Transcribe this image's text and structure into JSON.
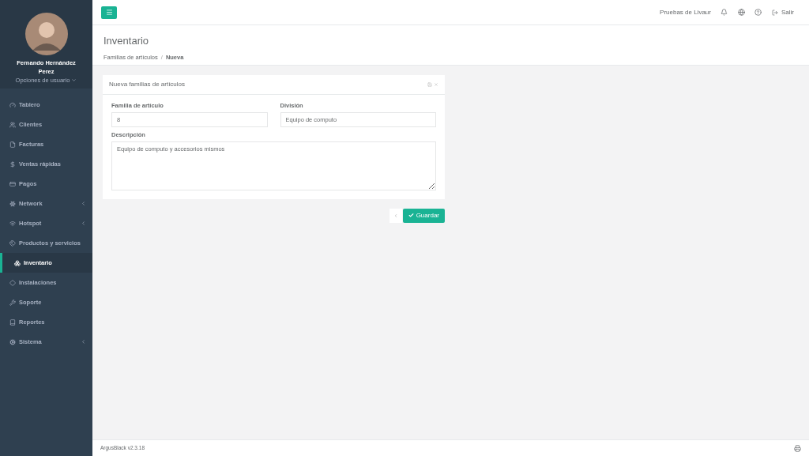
{
  "user": {
    "name": "Fernando Hernández Perez",
    "options": "Opciones de usuario"
  },
  "sidebar": {
    "items": [
      {
        "label": "Tablero",
        "has_submenu": false,
        "selected": false
      },
      {
        "label": "Clientes",
        "has_submenu": false,
        "selected": false
      },
      {
        "label": "Facturas",
        "has_submenu": false,
        "selected": false
      },
      {
        "label": "Ventas rápidas",
        "has_submenu": false,
        "selected": false
      },
      {
        "label": "Pagos",
        "has_submenu": false,
        "selected": false
      },
      {
        "label": "Network",
        "has_submenu": true,
        "selected": false
      },
      {
        "label": "Hotspot",
        "has_submenu": true,
        "selected": false
      },
      {
        "label": "Productos y servicios",
        "has_submenu": false,
        "selected": false
      },
      {
        "label": "Inventario",
        "has_submenu": false,
        "selected": true
      },
      {
        "label": "Instalaciones",
        "has_submenu": false,
        "selected": false
      },
      {
        "label": "Soporte",
        "has_submenu": false,
        "selected": false
      },
      {
        "label": "Reportes",
        "has_submenu": false,
        "selected": false
      },
      {
        "label": "Sistema",
        "has_submenu": true,
        "selected": false
      }
    ]
  },
  "topbar": {
    "account": "Pruebas de Livaur",
    "logout": "Salir"
  },
  "page": {
    "title": "Inventario",
    "breadcrumb": [
      "Familias de artículos",
      "Nueva"
    ],
    "breadcrumb_separator": "/"
  },
  "form": {
    "title": "Nueva familias de artículos",
    "fields": [
      {
        "label": "Familia de artículo",
        "value": "8"
      },
      {
        "label": "División",
        "value": "Equipo de computo"
      }
    ],
    "description": {
      "label": "Descripción",
      "value": "Equipo de computo y accesorios mismos"
    },
    "save": "Guardar"
  },
  "footer": {
    "version": "ArgusBlack v2.3.18"
  }
}
